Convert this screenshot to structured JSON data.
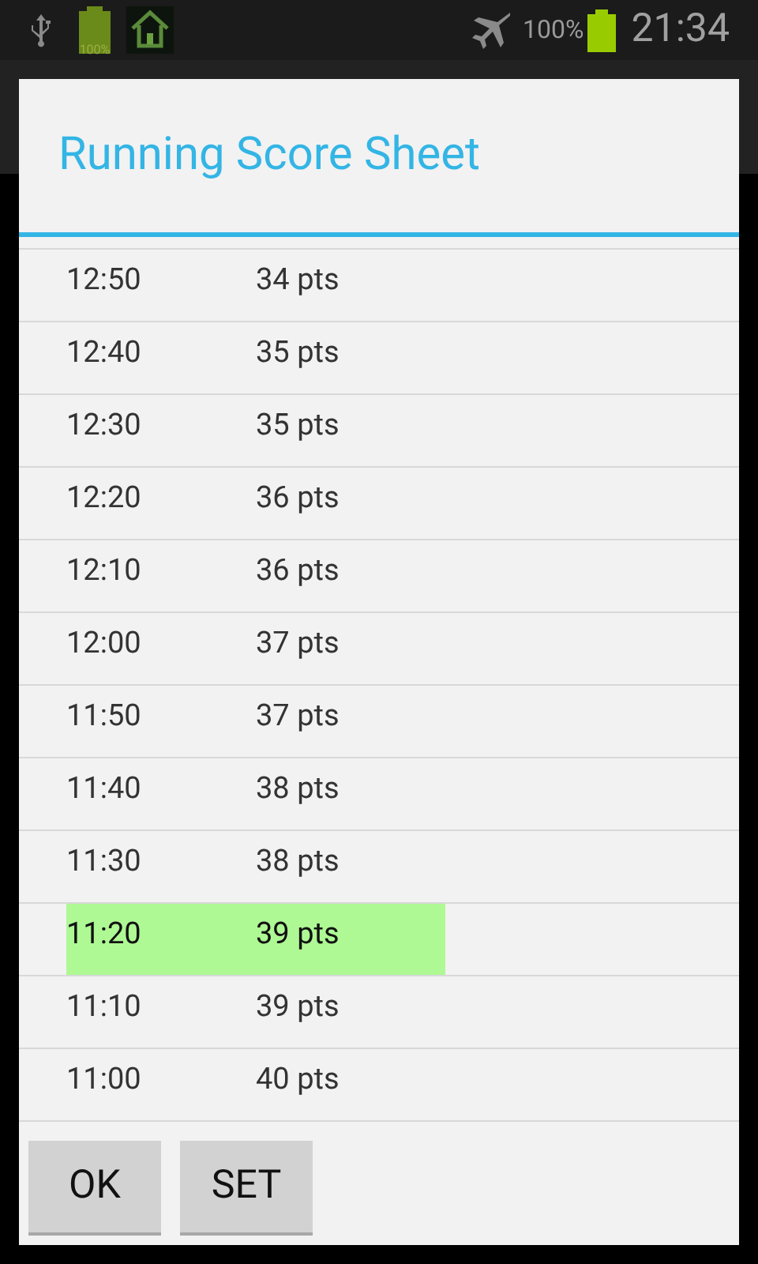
{
  "status_bar": {
    "app_battery_label": "100%",
    "battery_percent": "100%",
    "time": "21:34"
  },
  "dialog": {
    "title": "Running Score Sheet",
    "rows": [
      {
        "time": "12:50",
        "score": "34 pts",
        "selected": false
      },
      {
        "time": "12:40",
        "score": "35 pts",
        "selected": false
      },
      {
        "time": "12:30",
        "score": "35 pts",
        "selected": false
      },
      {
        "time": "12:20",
        "score": "36 pts",
        "selected": false
      },
      {
        "time": "12:10",
        "score": "36 pts",
        "selected": false
      },
      {
        "time": "12:00",
        "score": "37 pts",
        "selected": false
      },
      {
        "time": "11:50",
        "score": "37 pts",
        "selected": false
      },
      {
        "time": "11:40",
        "score": "38 pts",
        "selected": false
      },
      {
        "time": "11:30",
        "score": "38 pts",
        "selected": false
      },
      {
        "time": "11:20",
        "score": "39 pts",
        "selected": true
      },
      {
        "time": "11:10",
        "score": "39 pts",
        "selected": false
      },
      {
        "time": "11:00",
        "score": "40 pts",
        "selected": false
      }
    ],
    "buttons": [
      "OK",
      "SET"
    ]
  }
}
